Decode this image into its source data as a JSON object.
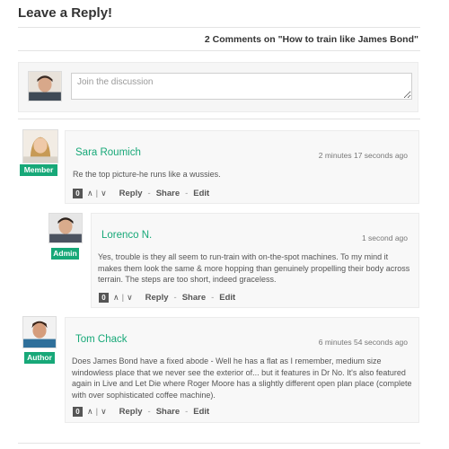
{
  "section": {
    "title": "Leave a Reply!",
    "comment_count": "2 Comments on \"How to train like James Bond\""
  },
  "compose": {
    "placeholder": "Join the discussion"
  },
  "actions": {
    "reply": "Reply",
    "share": "Share",
    "edit": "Edit",
    "up_icon": "∧",
    "down_icon": "∨",
    "divider": "|",
    "separator": "-"
  },
  "comments": [
    {
      "author": "Sara Roumich",
      "badge": "Member",
      "time": "2 minutes 17 seconds ago",
      "text": "Re the top picture-he runs like a wussies.",
      "votes": "0"
    },
    {
      "author": "Lorenco N.",
      "badge": "Admin",
      "time": "1 second ago",
      "text": "Yes, trouble is they all seem to run-train with on-the-spot machines. To my mind it makes them look the same & more hopping than genuinely propelling their body across terrain. The steps are too short, indeed graceless.",
      "votes": "0"
    },
    {
      "author": "Tom Chack",
      "badge": "Author",
      "time": "6 minutes 54 seconds ago",
      "text": "Does James Bond have a fixed abode - Well he has a flat as I remember, medium size windowless place that we never see the exterior of... but it features in Dr No. It's also featured again in Live and Let Die where Roger Moore has a slightly different open plan place (complete with over sophisticated coffee machine).",
      "votes": "0"
    }
  ],
  "colors": {
    "accent": "#17a878",
    "background": "#ffffff",
    "card": "#f8f8f8"
  }
}
